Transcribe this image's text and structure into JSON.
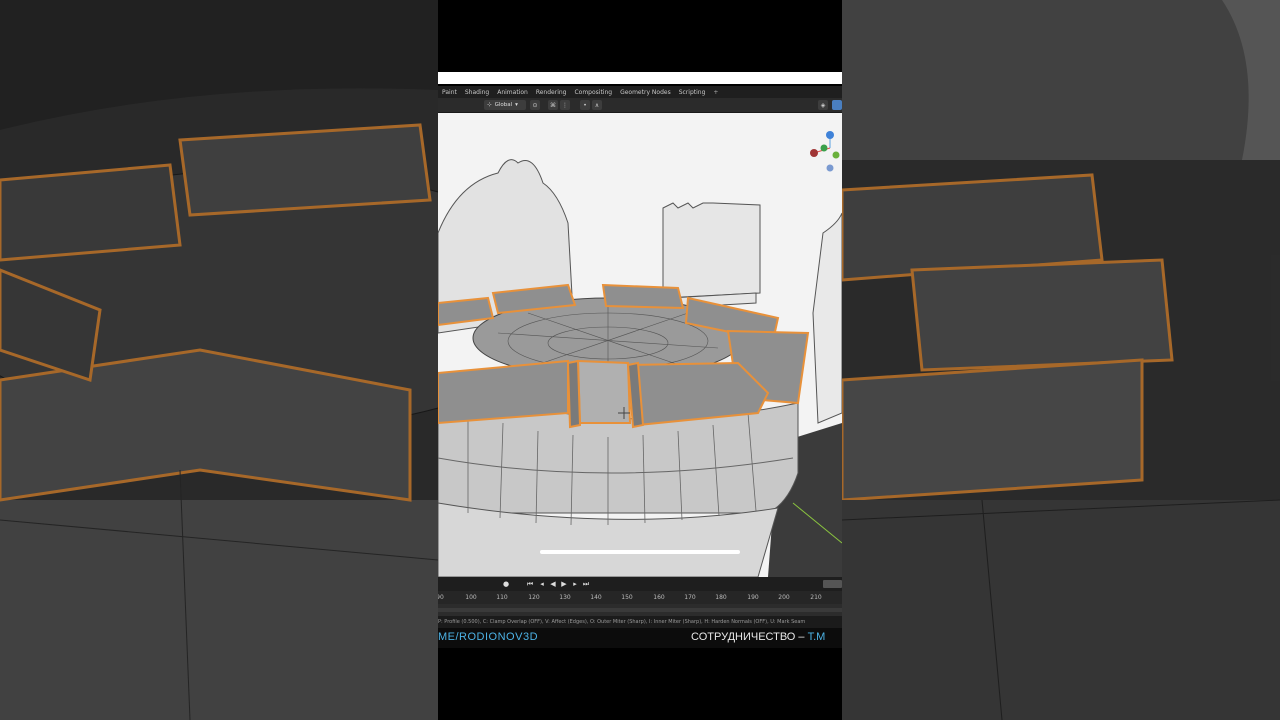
{
  "workspace_tabs": [
    "Paint",
    "Shading",
    "Animation",
    "Rendering",
    "Compositing",
    "Geometry Nodes",
    "Scripting",
    "+"
  ],
  "toolbar": {
    "transform_orientation": "Global"
  },
  "timeline": {
    "ticks": [
      "90",
      "100",
      "110",
      "120",
      "130",
      "140",
      "150",
      "160",
      "170",
      "180",
      "190",
      "200",
      "210"
    ]
  },
  "status_bar": "P: Profile (0.500), C: Clamp Overlap (OFF), V: Affect (Edges), O: Outer Miter (Sharp), I: Inner Miter (Sharp), H: Harden Normals (OFF), U: Mark Seam",
  "caption": {
    "left": "ME/RODIONOV3D",
    "right_prefix": "СОТРУДНИЧЕСТВО – ",
    "right_link": "T.M"
  },
  "colors": {
    "selection_orange": "#e8913a",
    "caption_blue": "#4db3e6",
    "mesh_gray": "#8f8f8f"
  },
  "icons": [
    "snap-icon",
    "proportional-icon",
    "axis-gizmo",
    "cursor-crosshair-icon"
  ]
}
